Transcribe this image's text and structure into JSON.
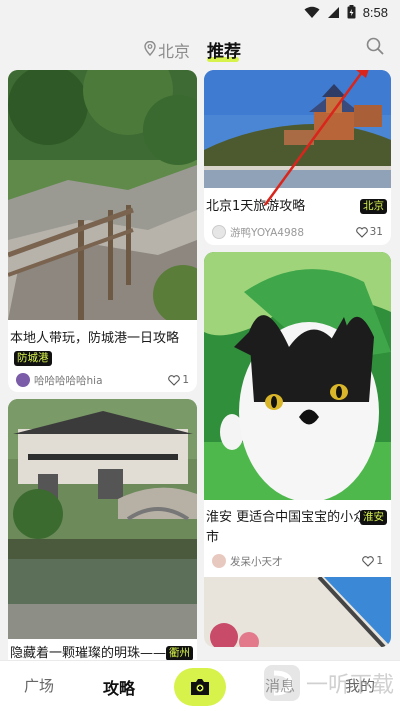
{
  "status_bar": {
    "time": "8:58"
  },
  "header": {
    "location": "北京",
    "active_tab": "推荐"
  },
  "feed": {
    "cards": [
      {
        "title": "本地人带玩，防城港一日攻略",
        "tag": "防城港",
        "author": "哈哈哈哈哈hia",
        "likes": "1"
      },
      {
        "title": "北京1天旅游攻略",
        "tag": "北京",
        "author": "游鸭YOYA4988",
        "likes": "31"
      },
      {
        "title": "淮安 更适合中国宝宝的小众城市",
        "tag": "淮安",
        "author": "发呆小天才",
        "likes": "1"
      },
      {
        "title": "隐藏着一颗璀璨的明珠——",
        "tag": "衢州",
        "author": "",
        "likes": ""
      }
    ]
  },
  "bottom_nav": {
    "items": [
      {
        "label": "广场"
      },
      {
        "label": "攻略"
      },
      {
        "label": "消息"
      },
      {
        "label": "我的"
      }
    ]
  },
  "watermark": {
    "text": "一听下载"
  },
  "colors": {
    "accent": "#d7f24a",
    "tag_bg": "#111111"
  }
}
